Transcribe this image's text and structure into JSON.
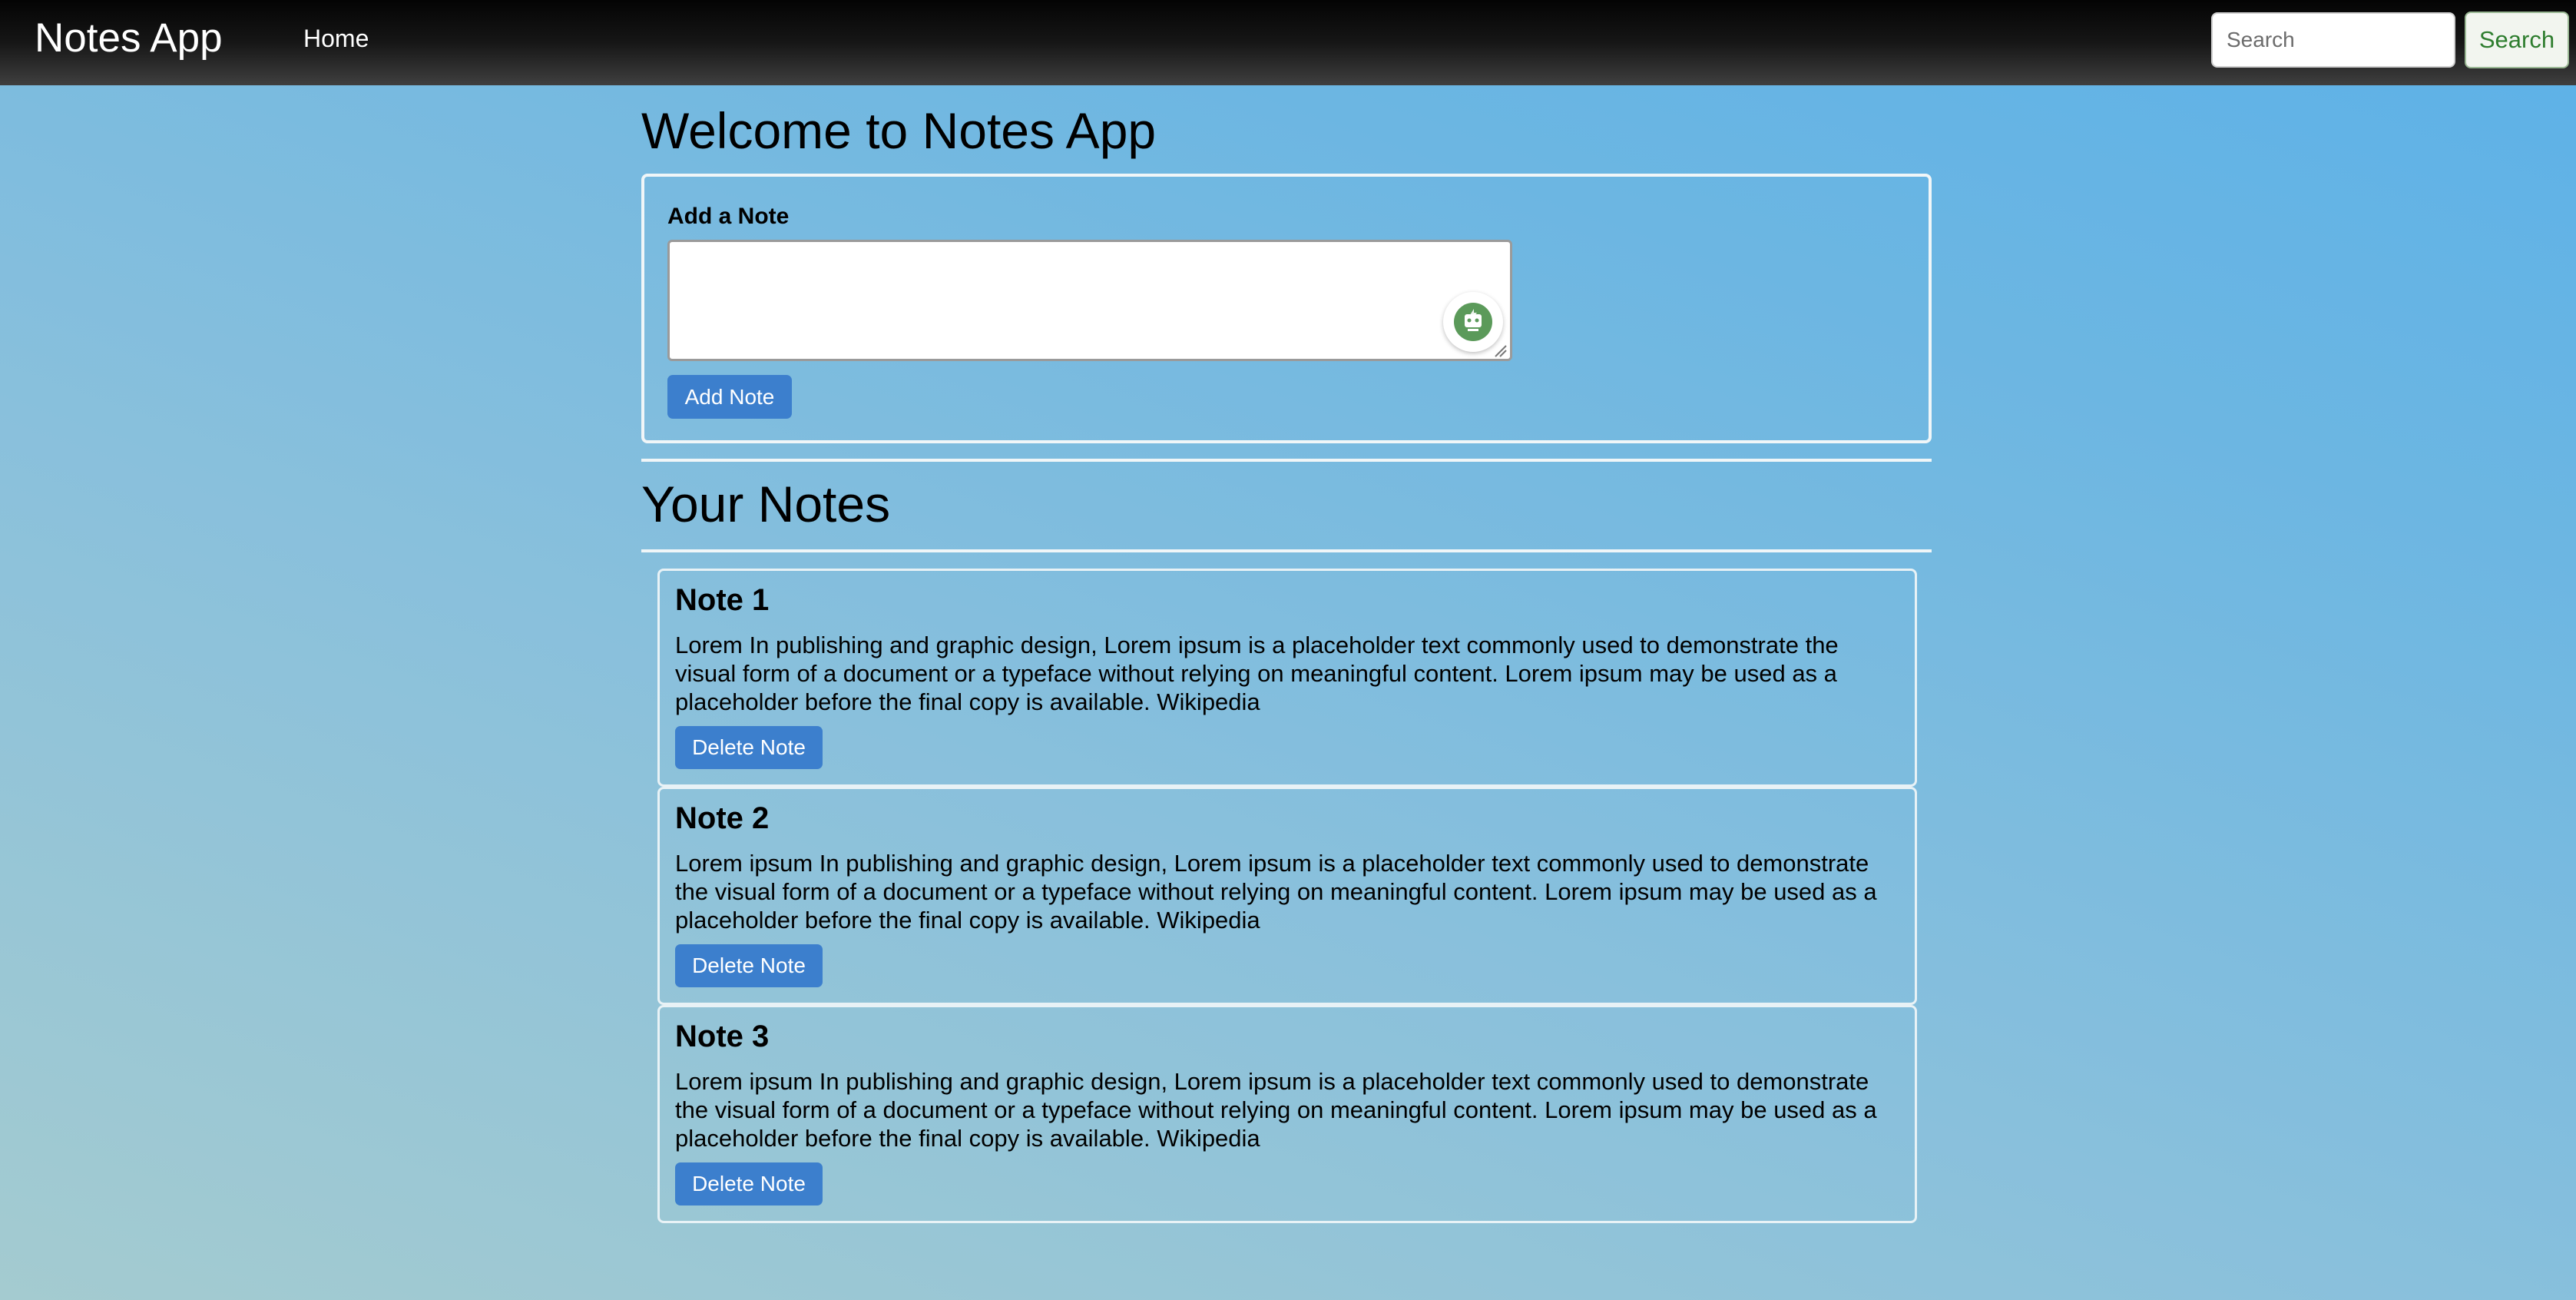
{
  "navbar": {
    "brand": "Notes App",
    "home_label": "Home",
    "search_placeholder": "Search",
    "search_button_label": "Search"
  },
  "main": {
    "welcome_title": "Welcome to Notes App",
    "add_note_label": "Add a Note",
    "note_textarea_value": "",
    "add_note_button_label": "Add Note",
    "your_notes_title": "Your Notes",
    "notes": [
      {
        "title": "Note 1",
        "body": "Lorem In publishing and graphic design, Lorem ipsum is a placeholder text commonly used to demonstrate the visual form of a document or a typeface without relying on meaningful content. Lorem ipsum may be used as a placeholder before the final copy is available. Wikipedia",
        "delete_label": "Delete Note"
      },
      {
        "title": "Note 2",
        "body": "Lorem ipsum In publishing and graphic design, Lorem ipsum is a placeholder text commonly used to demonstrate the visual form of a document or a typeface without relying on meaningful content. Lorem ipsum may be used as a placeholder before the final copy is available. Wikipedia",
        "delete_label": "Delete Note"
      },
      {
        "title": "Note 3",
        "body": "Lorem ipsum In publishing and graphic design, Lorem ipsum is a placeholder text commonly used to demonstrate the visual form of a document or a typeface without relying on meaningful content. Lorem ipsum may be used as a placeholder before the final copy is available. Wikipedia",
        "delete_label": "Delete Note"
      }
    ]
  },
  "icons": {
    "grammar_badge": "grammar-assistant-icon",
    "resize_grip": "resize-grip-icon"
  },
  "colors": {
    "primary_button": "#3c7fcd",
    "search_button_text": "#2e7d2e",
    "navbar": "#1a1a1a"
  }
}
